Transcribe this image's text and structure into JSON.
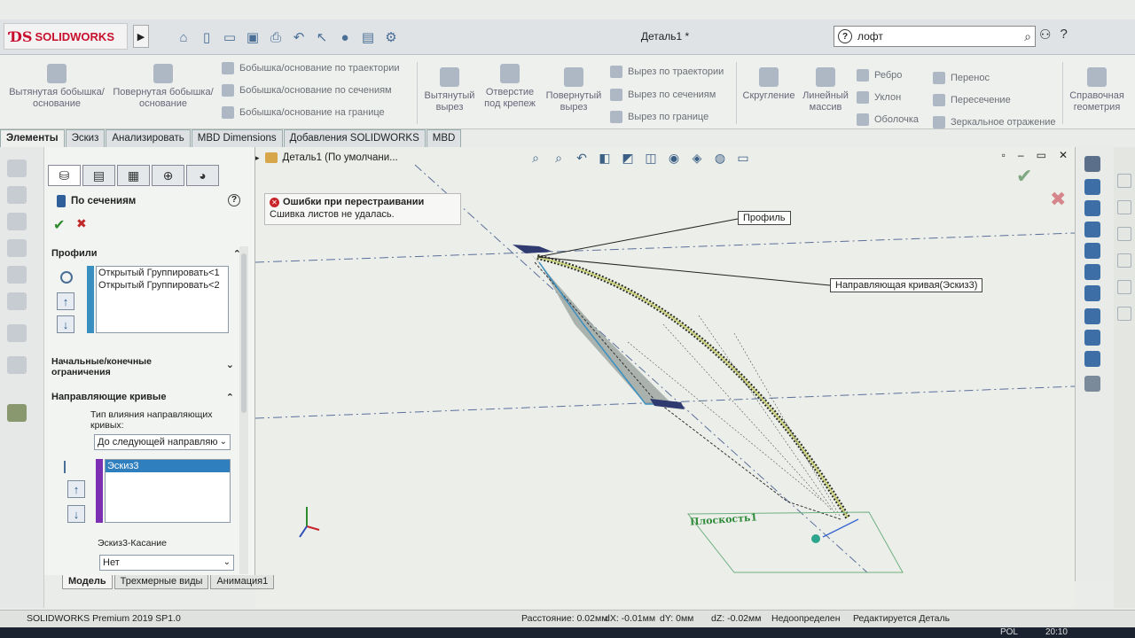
{
  "app": {
    "name": "SOLIDWORKS",
    "document_title": "Деталь1 *",
    "search_value": "лофт"
  },
  "ribbon": {
    "col1": [
      {
        "label": "Вытянутая бобышка/основание"
      },
      {
        "label": "Повернутая бобышка/основание"
      }
    ],
    "col2": [
      {
        "label": "Бобышка/основание по траектории"
      },
      {
        "label": "Бобышка/основание по сечениям"
      },
      {
        "label": "Бобышка/основание на границе"
      }
    ],
    "col3": [
      {
        "label": "Вытянутый вырез"
      },
      {
        "label": "Отверстие под крепеж"
      },
      {
        "label": "Повернутый вырез"
      }
    ],
    "col4": [
      {
        "label": "Вырез по траектории"
      },
      {
        "label": "Вырез по сечениям"
      },
      {
        "label": "Вырез по границе"
      }
    ],
    "col5": [
      {
        "label": "Скругление"
      },
      {
        "label": "Линейный массив"
      }
    ],
    "col6": [
      {
        "label": "Ребро"
      },
      {
        "label": "Уклон"
      },
      {
        "label": "Оболочка"
      }
    ],
    "col7": [
      {
        "label": "Перенос"
      },
      {
        "label": "Пересечение"
      },
      {
        "label": "Зеркальное отражение"
      }
    ],
    "col8": [
      {
        "label": "Справочная геометрия"
      }
    ]
  },
  "tabs": [
    "Элементы",
    "Эскиз",
    "Анализировать",
    "MBD Dimensions",
    "Добавления SOLIDWORKS",
    "MBD"
  ],
  "property_manager": {
    "title": "По сечениям",
    "profiles_header": "Профили",
    "profiles": [
      "Открытый Группировать<1",
      "Открытый Группировать<2"
    ],
    "start_end_header": "Начальные/конечные ограничения",
    "guides_header": "Направляющие кривые",
    "guide_influence_label": "Тип влияния направляющих кривых:",
    "guide_influence_value": "До следующей направляю",
    "guides": [
      "Эскиз3"
    ],
    "tangency_label": "Эскиз3-Касание",
    "tangency_value": "Нет"
  },
  "viewport": {
    "tree_label": "Деталь1 (По умолчани...",
    "error_title": "Ошибки при перестраивании",
    "error_message": "Сшивка листов не удалась.",
    "callout_profile": "Профиль",
    "callout_guide": "Направляющая кривая(Эскиз3)",
    "plane_label": "Плоскость1"
  },
  "bottom_tabs": [
    "Модель",
    "Трехмерные виды",
    "Анимация1"
  ],
  "status": {
    "product": "SOLIDWORKS Premium 2019 SP1.0",
    "distance": "Расстояние: 0.02мм",
    "dx": "dX: -0.01мм",
    "dy": "dY: 0мм",
    "dz": "dZ: -0.02мм",
    "state": "Недоопределен",
    "editing": "Редактируется Деталь"
  },
  "taskbar": {
    "lang": "POL",
    "time": "20:10"
  },
  "colors": {
    "accent": "#c8102e",
    "profile_strip": "#3a8fc1",
    "guide_strip": "#7b2fb2",
    "selection": "#2f7ebd"
  }
}
